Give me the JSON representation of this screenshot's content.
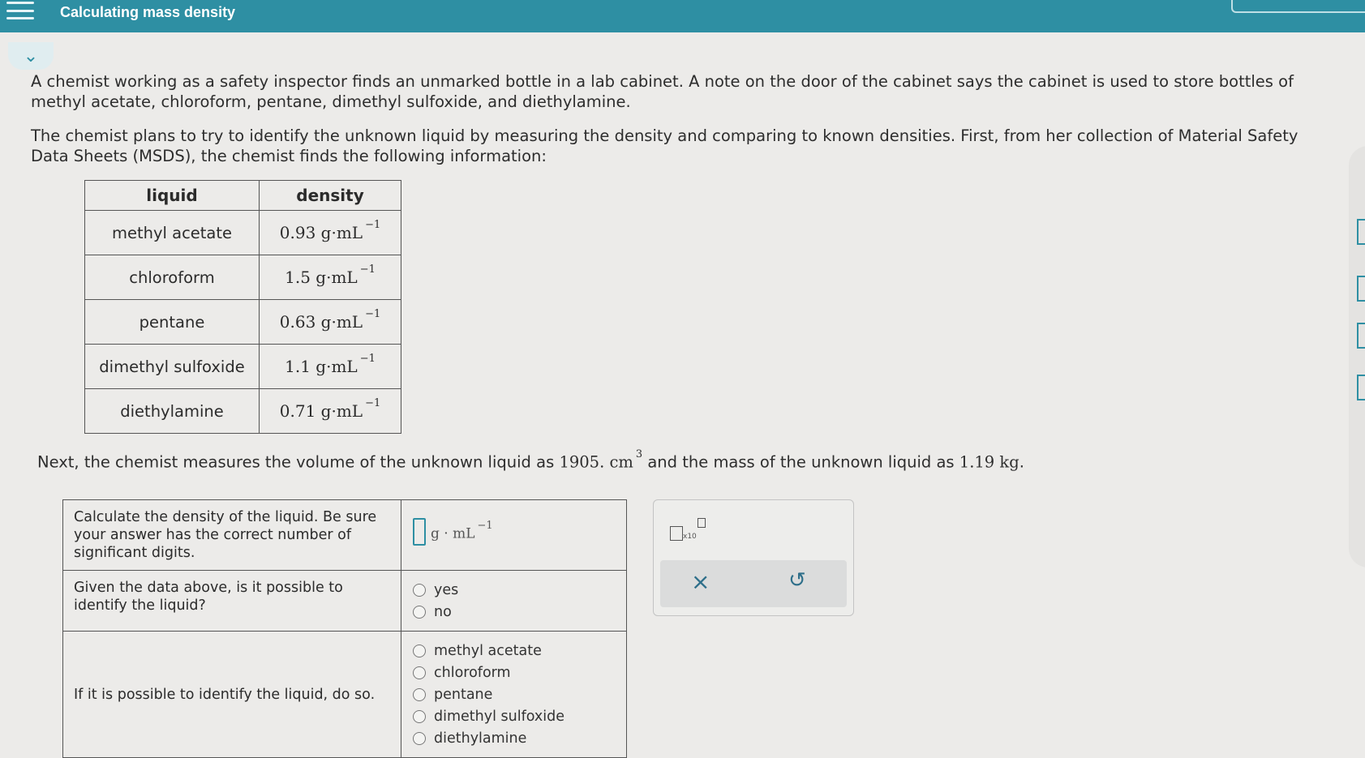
{
  "header": {
    "title": "Calculating mass density"
  },
  "intro": {
    "paragraph1": "A chemist working as a safety inspector finds an unmarked bottle in a lab cabinet. A note on the door of the cabinet says the cabinet is used to store bottles of methyl acetate, chloroform, pentane, dimethyl sulfoxide, and diethylamine.",
    "paragraph2": "The chemist plans to try to identify the unknown liquid by measuring the density and comparing to known densities. First, from her collection of Material Safety Data Sheets (MSDS), the chemist finds the following information:"
  },
  "density_table": {
    "headers": [
      "liquid",
      "density"
    ],
    "rows": [
      {
        "liquid": "methyl acetate",
        "value": "0.93",
        "unit": "g·mL",
        "exp": "−1"
      },
      {
        "liquid": "chloroform",
        "value": "1.5",
        "unit": "g·mL",
        "exp": "−1"
      },
      {
        "liquid": "pentane",
        "value": "0.63",
        "unit": "g·mL",
        "exp": "−1"
      },
      {
        "liquid": "dimethyl sulfoxide",
        "value": "1.1",
        "unit": "g·mL",
        "exp": "−1"
      },
      {
        "liquid": "diethylamine",
        "value": "0.71",
        "unit": "g·mL",
        "exp": "−1"
      }
    ]
  },
  "measurement": {
    "text_a": "Next, the chemist measures the volume of the unknown liquid as ",
    "volume": "1905. cm",
    "volume_exp": "3",
    "text_b": " and the mass of the unknown liquid as ",
    "mass": "1.19 kg",
    "text_c": "."
  },
  "questions": {
    "q1": {
      "prompt": "Calculate the density of the liquid. Be sure your answer has the correct number of significant digits.",
      "unit": "g · mL",
      "unit_exp": "−1",
      "value": ""
    },
    "q2": {
      "prompt": "Given the data above, is it possible to identify the liquid?",
      "options": [
        "yes",
        "no"
      ]
    },
    "q3": {
      "prompt": "If it is possible to identify the liquid, do so.",
      "options": [
        "methyl acetate",
        "chloroform",
        "pentane",
        "dimethyl sulfoxide",
        "diethylamine"
      ]
    }
  },
  "tools": {
    "x10_label": "x10",
    "clear_symbol": "×",
    "undo_symbol": "↺"
  },
  "icons": {
    "menu": "menu-icon",
    "collapse": "chevron-down-icon",
    "clear": "close-icon",
    "undo": "undo-icon"
  },
  "colors": {
    "header_bg": "#2e8fa3",
    "accent": "#2e8fa3",
    "page_bg": "#ecebe9"
  }
}
